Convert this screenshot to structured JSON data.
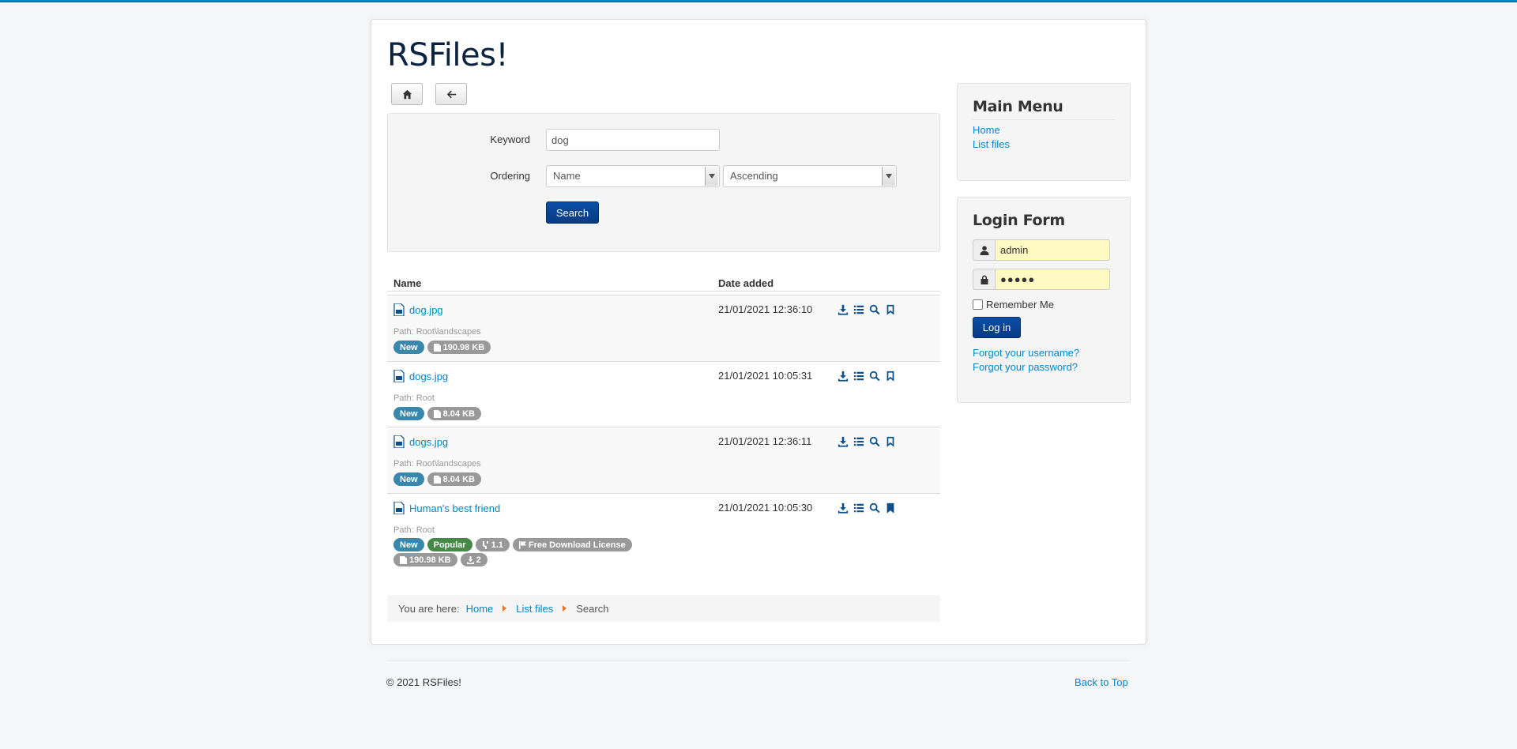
{
  "site": {
    "title": "RSFiles!"
  },
  "nav": {
    "home_icon": "home-icon",
    "back_icon": "arrow-left-icon"
  },
  "search": {
    "keyword_label": "Keyword",
    "keyword_value": "dog",
    "ordering_label": "Ordering",
    "ordering_field": "Name",
    "ordering_direction": "Ascending",
    "button_label": "Search"
  },
  "table": {
    "columns": [
      "Name",
      "Date added"
    ],
    "rows": [
      {
        "name": "dog.jpg",
        "date": "21/01/2021 12:36:10",
        "path": "Path: Root\\landscapes",
        "badges": [
          {
            "label": "New",
            "type": "new"
          },
          {
            "label": "190.98 KB",
            "type": "size",
            "icon": "file-icon"
          }
        ],
        "bookmarked": false
      },
      {
        "name": "dogs.jpg",
        "date": "21/01/2021 10:05:31",
        "path": "Path: Root",
        "badges": [
          {
            "label": "New",
            "type": "new"
          },
          {
            "label": "8.04 KB",
            "type": "size",
            "icon": "file-icon"
          }
        ],
        "bookmarked": false
      },
      {
        "name": "dogs.jpg",
        "date": "21/01/2021 12:36:11",
        "path": "Path: Root\\landscapes",
        "badges": [
          {
            "label": "New",
            "type": "new"
          },
          {
            "label": "8.04 KB",
            "type": "size",
            "icon": "file-icon"
          }
        ],
        "bookmarked": false
      },
      {
        "name": "Human's best friend",
        "date": "21/01/2021 10:05:30",
        "path": "Path: Root",
        "badges": [
          {
            "label": "New",
            "type": "new"
          },
          {
            "label": "Popular",
            "type": "popular"
          },
          {
            "label": "1.1",
            "type": "version",
            "icon": "branch-icon"
          },
          {
            "label": "Free Download License",
            "type": "license",
            "icon": "flag-icon"
          }
        ],
        "badges2": [
          {
            "label": "190.98 KB",
            "type": "size",
            "icon": "file-icon"
          },
          {
            "label": "2",
            "type": "downloads",
            "icon": "download-icon"
          }
        ],
        "bookmarked": true
      }
    ]
  },
  "breadcrumb": {
    "prefix": "You are here:",
    "items": [
      "Home",
      "List files",
      "Search"
    ]
  },
  "main_menu": {
    "title": "Main Menu",
    "items": [
      "Home",
      "List files"
    ]
  },
  "login": {
    "title": "Login Form",
    "username": "admin",
    "password_mask": "●●●●●",
    "remember_label": "Remember Me",
    "button_label": "Log in",
    "forgot_username": "Forgot your username?",
    "forgot_password": "Forgot your password?"
  },
  "footer": {
    "copyright": "© 2021 RSFiles!",
    "back_to_top": "Back to Top"
  },
  "colors": {
    "accent": "#0088cc",
    "primary_button": "#0b4fa6",
    "badge_new": "#3a87ad",
    "badge_popular": "#468847",
    "badge_grey": "#999999",
    "login_field_bg": "#fff9c4"
  }
}
